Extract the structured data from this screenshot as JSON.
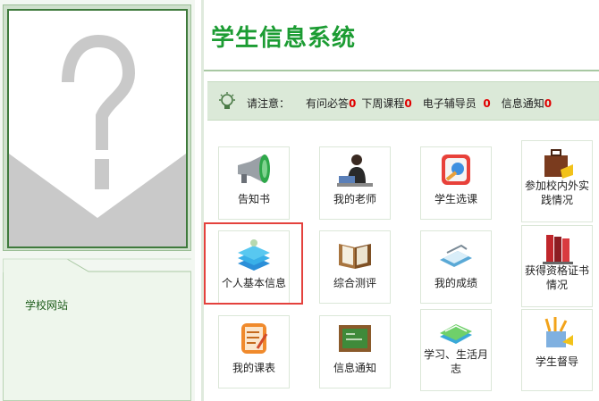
{
  "app": {
    "title": "学生信息系统"
  },
  "sidebar": {
    "links": [
      {
        "label": "学校网站"
      }
    ]
  },
  "notice": {
    "prefix": "请注意：",
    "items": [
      {
        "label": "有问必答",
        "count": "0"
      },
      {
        "label": "下周课程",
        "count": "0"
      },
      {
        "label": "电子辅导员",
        "count": "0"
      },
      {
        "label": "信息通知",
        "count": "0"
      }
    ]
  },
  "tiles": [
    {
      "label": "告知书",
      "icon": "megaphone-icon"
    },
    {
      "label": "我的老师",
      "icon": "teacher-icon"
    },
    {
      "label": "学生选课",
      "icon": "course-select-icon"
    },
    {
      "label": "参加校内外实践情况",
      "icon": "briefcase-icon"
    },
    {
      "label": "个人基本信息",
      "icon": "book-stack-icon",
      "selected": true
    },
    {
      "label": "综合测评",
      "icon": "open-book-icon"
    },
    {
      "label": "我的成绩",
      "icon": "grades-icon"
    },
    {
      "label": "获得资格证书情况",
      "icon": "certificate-books-icon"
    },
    {
      "label": "我的课表",
      "icon": "notepad-icon"
    },
    {
      "label": "信息通知",
      "icon": "chalkboard-icon"
    },
    {
      "label": "学习、生活月志",
      "icon": "journal-icon"
    },
    {
      "label": "学生督导",
      "icon": "pencil-cup-icon"
    }
  ],
  "colors": {
    "title": "#1c9c33",
    "highlight": "#e4413d",
    "count": "#e00000",
    "panel": "#dbe9d8"
  }
}
